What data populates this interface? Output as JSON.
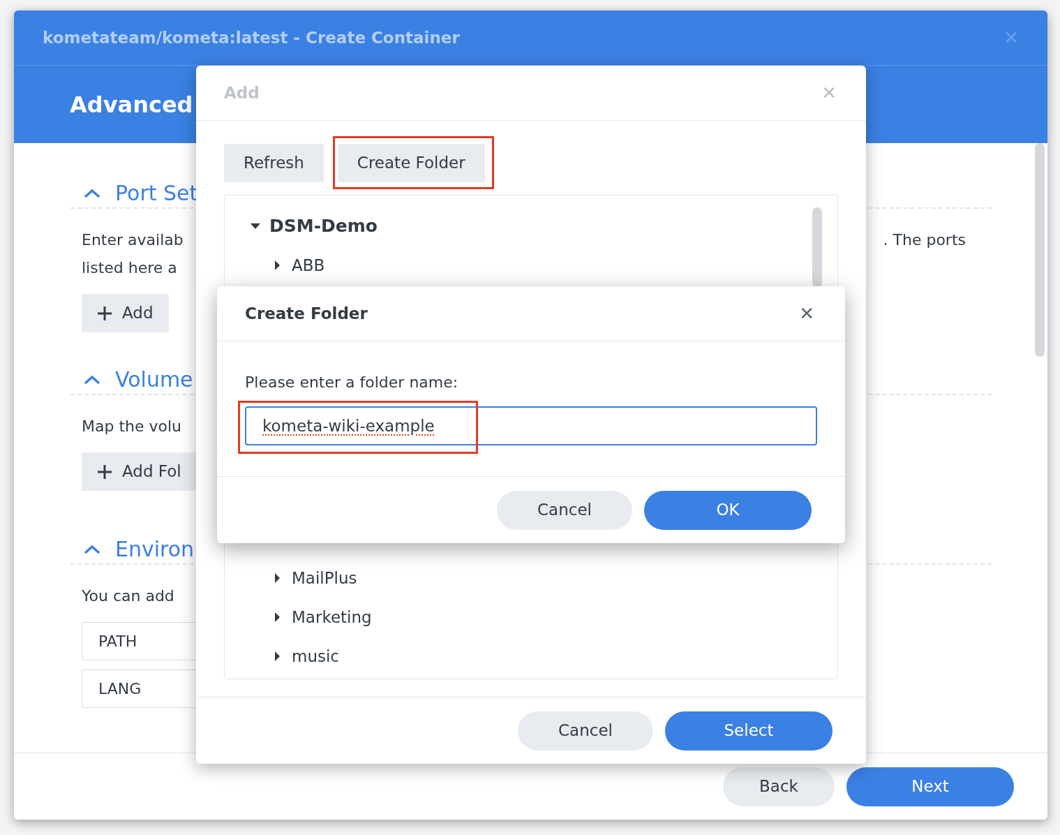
{
  "window": {
    "title": "kometateam/kometa:latest - Create Container",
    "close": "✕"
  },
  "header": {
    "title": "Advanced"
  },
  "sections": [
    {
      "title": "Port Set",
      "lines": [
        {
          "left": "Enter availab",
          "right": ". The ports"
        },
        {
          "left": "listed here a"
        }
      ],
      "button": "Add"
    },
    {
      "title": "Volume",
      "lines": [
        {
          "left": "Map the volu"
        }
      ],
      "button": "Add Fol"
    },
    {
      "title": "Environ",
      "lines": [
        {
          "left": "You can add"
        }
      ],
      "fields": [
        "PATH",
        "LANG"
      ]
    }
  ],
  "footer_buttons": [
    {
      "label": "Back",
      "kind": "secondary"
    },
    {
      "label": "Next",
      "kind": "primary"
    }
  ],
  "add_dialog": {
    "title": "Add",
    "close": "✕",
    "toolbar": [
      {
        "label": "Refresh",
        "highlighted": false
      },
      {
        "label": "Create Folder",
        "highlighted": true
      }
    ],
    "tree": [
      {
        "label": "DSM-Demo",
        "expanded": true,
        "children": [
          {
            "label": "ABB",
            "expanded": false
          },
          {
            "label": "MailPlus",
            "expanded": false
          },
          {
            "label": "Marketing",
            "expanded": false
          },
          {
            "label": "music",
            "expanded": false
          }
        ]
      }
    ],
    "buttons": [
      {
        "label": "Cancel",
        "kind": "secondary"
      },
      {
        "label": "Select",
        "kind": "primary"
      }
    ]
  },
  "create_folder_dialog": {
    "title": "Create Folder",
    "close": "✕",
    "prompt": "Please enter a folder name:",
    "input": {
      "value": "kometa-wiki-example",
      "highlighted": true,
      "spelling_error": true
    },
    "buttons": [
      {
        "label": "Cancel",
        "kind": "secondary"
      },
      {
        "label": "OK",
        "kind": "primary"
      }
    ]
  }
}
